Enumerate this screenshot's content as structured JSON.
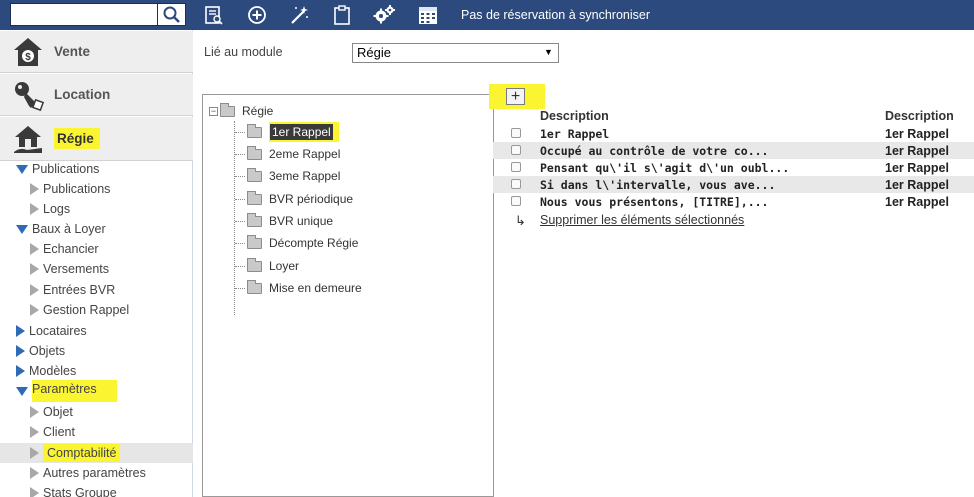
{
  "topbar": {
    "search_placeholder": "",
    "status": "Pas de réservation à synchroniser",
    "icons": [
      "search-icon",
      "report-icon",
      "add-circle-icon",
      "magic-wand-icon",
      "clipboard-icon",
      "settings-icon",
      "calendar-icon"
    ]
  },
  "sidebar": {
    "modules": [
      {
        "label": "Vente",
        "icon": "house-dollar-icon"
      },
      {
        "label": "Location",
        "icon": "key-icon"
      },
      {
        "label": "Régie",
        "icon": "house-hand-icon"
      }
    ],
    "nav": [
      {
        "label": "Publications",
        "level": 0,
        "state": "expanded"
      },
      {
        "label": "Publications",
        "level": 1
      },
      {
        "label": "Logs",
        "level": 1
      },
      {
        "label": "Baux à Loyer",
        "level": 0,
        "state": "expanded"
      },
      {
        "label": "Echancier",
        "level": 1
      },
      {
        "label": "Versements",
        "level": 1
      },
      {
        "label": "Entrées BVR",
        "level": 1
      },
      {
        "label": "Gestion Rappel",
        "level": 1
      },
      {
        "label": "Locataires",
        "level": 0,
        "state": "collapsed"
      },
      {
        "label": "Objets",
        "level": 0,
        "state": "collapsed"
      },
      {
        "label": "Modèles",
        "level": 0,
        "state": "collapsed"
      },
      {
        "label": "Paramètres",
        "level": 0,
        "state": "expanded"
      },
      {
        "label": "Objet",
        "level": 1
      },
      {
        "label": "Client",
        "level": 1
      },
      {
        "label": "Comptabilité",
        "level": 1
      },
      {
        "label": "Autres paramètres",
        "level": 1
      },
      {
        "label": "Stats Groupe",
        "level": 1
      }
    ]
  },
  "main": {
    "lie_label": "Lié au module",
    "module_value": "Régie",
    "tree": {
      "root": "Régie",
      "children": [
        "1er Rappel",
        "2eme Rappel",
        "3eme Rappel",
        "BVR périodique",
        "BVR unique",
        "Décompte Régie",
        "Loyer",
        "Mise en demeure"
      ]
    },
    "add_label": "+",
    "grid": {
      "headers": [
        "Description",
        "Description"
      ],
      "rows": [
        [
          "1er Rappel",
          "1er Rappel"
        ],
        [
          "Occupé au contrôle de votre co...",
          "1er Rappel"
        ],
        [
          "Pensant qu\\'il s\\'agit d\\'un oubl...",
          "1er Rappel"
        ],
        [
          "Si dans l\\'intervalle, vous ave...",
          "1er Rappel"
        ],
        [
          "Nous vous présentons, [TITRE],...",
          "1er Rappel"
        ]
      ],
      "delete_link": "Supprimer les éléments sélectionnés"
    }
  },
  "colors": {
    "topbar": "#2c4a7d",
    "highlight": "#fbf531",
    "accent": "#2f6bb5"
  }
}
